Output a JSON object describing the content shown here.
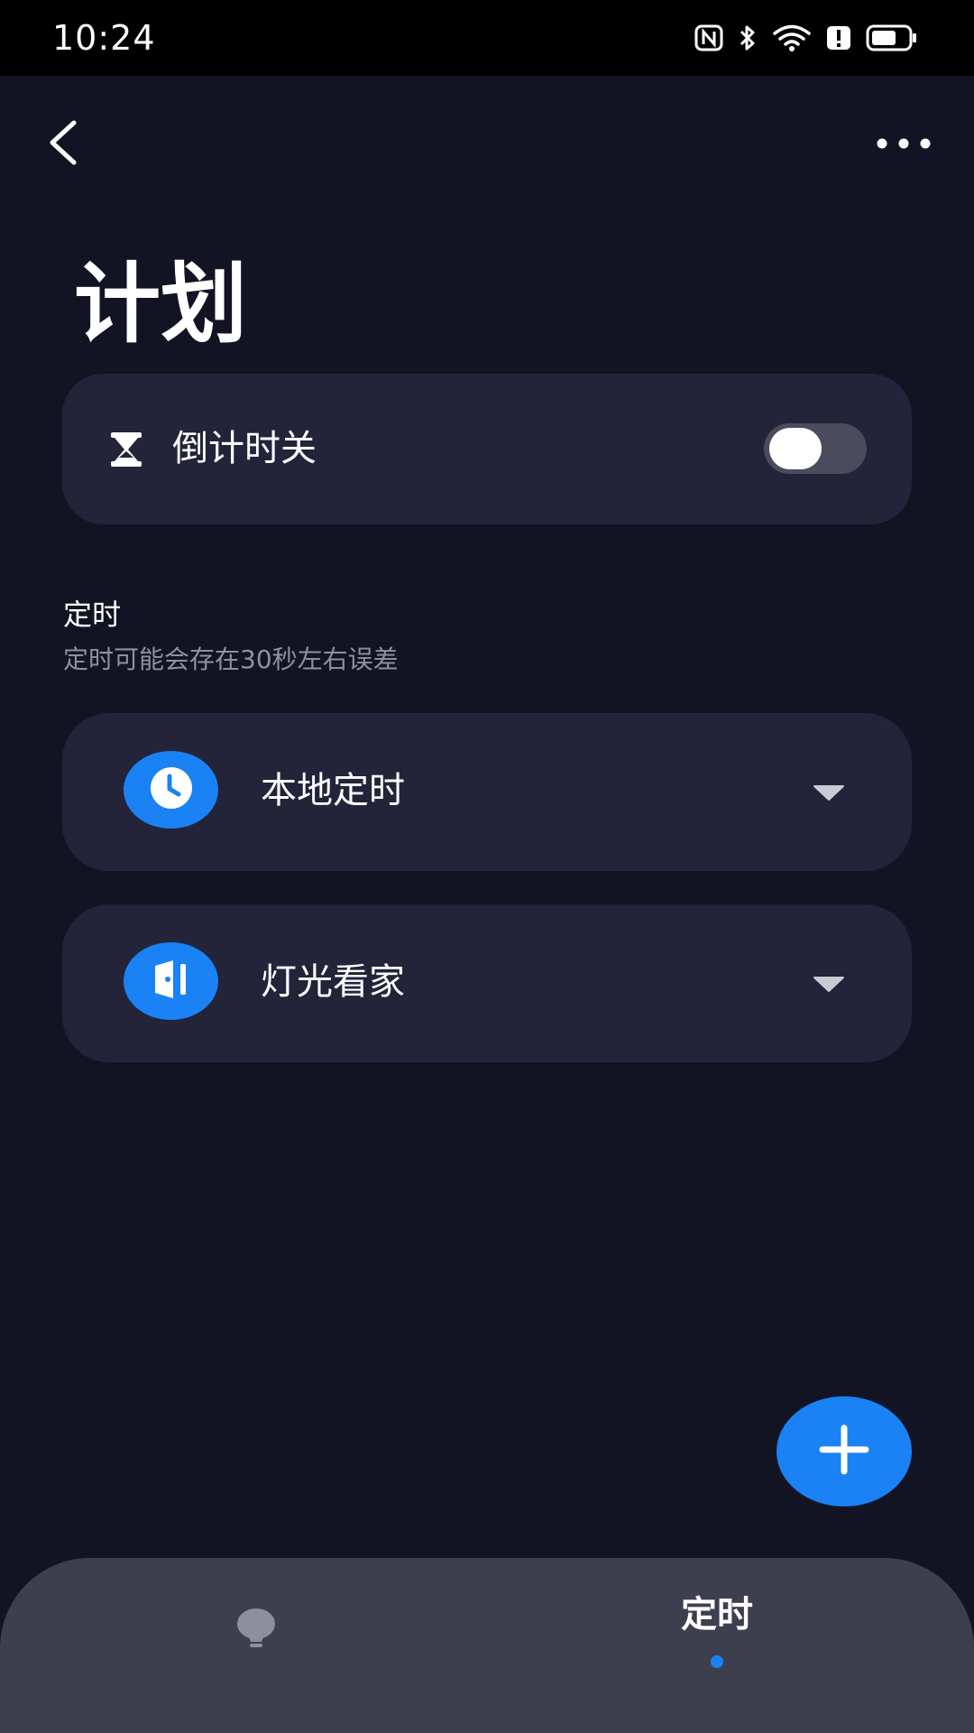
{
  "status_bar": {
    "time": "10:24",
    "icons": [
      "nfc-icon",
      "bluetooth-icon",
      "wifi-icon",
      "alert-icon",
      "battery-icon"
    ]
  },
  "header": {
    "back_icon": "chevron-left-icon",
    "more_icon": "more-horizontal-icon"
  },
  "page": {
    "title": "计划"
  },
  "countdown": {
    "icon": "hourglass-icon",
    "label": "倒计时关",
    "enabled": false
  },
  "timer_section": {
    "title": "定时",
    "subtitle": "定时可能会存在30秒左右误差",
    "items": [
      {
        "icon": "clock-icon",
        "label": "本地定时",
        "expand_icon": "chevron-down-icon"
      },
      {
        "icon": "door-icon",
        "label": "灯光看家",
        "expand_icon": "chevron-down-icon"
      }
    ]
  },
  "fab": {
    "icon": "plus-icon"
  },
  "bottom_nav": {
    "tabs": [
      {
        "icon": "bulb-icon",
        "label": ""
      },
      {
        "label": "定时",
        "active": true
      }
    ]
  },
  "colors": {
    "background": "#131423",
    "card": "#23243a",
    "accent": "#1a82f5",
    "nav": "#3e3f4e",
    "muted_text": "#8e90a0"
  }
}
